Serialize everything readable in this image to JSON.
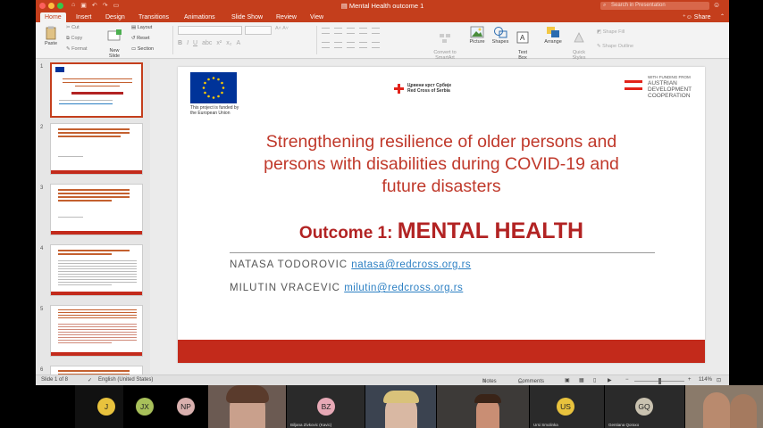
{
  "window": {
    "title": "Mental Health outcome 1",
    "search_placeholder": "Search in Presentation"
  },
  "colors": {
    "accent": "#c43e1c",
    "brand_red": "#c32a1b",
    "link": "#2b7fc3"
  },
  "tabs": [
    {
      "label": "Home"
    },
    {
      "label": "Insert"
    },
    {
      "label": "Design"
    },
    {
      "label": "Transitions"
    },
    {
      "label": "Animations"
    },
    {
      "label": "Slide Show"
    },
    {
      "label": "Review"
    },
    {
      "label": "View"
    }
  ],
  "share_label": "Share",
  "ribbon": {
    "paste": "Paste",
    "cut": "Cut",
    "copy": "Copy",
    "format": "Format",
    "new_slide": "New\nSlide",
    "layout": "Layout",
    "reset": "Reset",
    "section": "Section",
    "convert": "Convert to\nSmartArt",
    "picture": "Picture",
    "shapes": "Shapes",
    "text_box": "Text\nBox",
    "arrange": "Arrange",
    "quick_styles": "Quick\nStyles",
    "shape_fill": "Shape Fill",
    "shape_outline": "Shape Outline"
  },
  "thumbnails": [
    {
      "num": "1"
    },
    {
      "num": "2"
    },
    {
      "num": "3"
    },
    {
      "num": "4"
    },
    {
      "num": "5"
    },
    {
      "num": "6"
    }
  ],
  "slide": {
    "eu_caption": "This project is funded by the European Union",
    "rc_line1": "Црвени крст Србије",
    "rc_line2": "Red Cross of Serbia",
    "ada_funding": "WITH FUNDING FROM",
    "ada_line1": "AUSTRIAN",
    "ada_line2": "DEVELOPMENT",
    "ada_line3": "COOPERATION",
    "title_line1": "Strengthening resilience of older persons and",
    "title_line2": "persons with disabilities during COVID-19 and",
    "title_line3": "future disasters",
    "outcome_prefix": "Outcome 1: ",
    "outcome_main": "MENTAL HEALTH",
    "author1_name": "NATASA TODOROVIC",
    "author1_email": "natasa@redcross.org.rs",
    "author2_name": "MILUTIN VRACEVIC",
    "author2_email": "milutin@redcross.org.rs"
  },
  "statusbar": {
    "slide_count": "Slide 1 of 8",
    "language": "English (United States)",
    "notes": "Notes",
    "comments": "Comments",
    "zoom": "114%"
  },
  "participants": [
    {
      "initials": "J",
      "color": "#e8c23d",
      "name": ""
    },
    {
      "initials": "JX",
      "color": "#a8c05a",
      "name": ""
    },
    {
      "initials": "NP",
      "color": "#d9b0ae",
      "name": ""
    },
    {
      "initials": "",
      "color": "",
      "name": ""
    },
    {
      "initials": "BZ",
      "color": "#e7a9b6",
      "name": "Biljana Zivkovic (Kavic)"
    },
    {
      "initials": "",
      "color": "",
      "name": ""
    },
    {
      "initials": "",
      "color": "",
      "name": ""
    },
    {
      "initials": "US",
      "color": "#e8c23d",
      "name": "Ursi Smolinka"
    },
    {
      "initials": "GQ",
      "color": "#c9c2b0",
      "name": "Gentiana Qoraxo"
    },
    {
      "initials": "",
      "color": "",
      "name": ""
    }
  ]
}
